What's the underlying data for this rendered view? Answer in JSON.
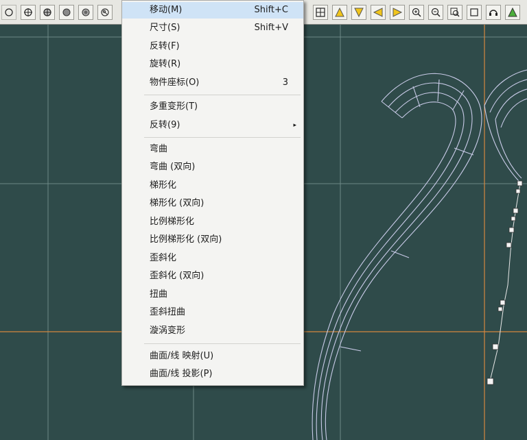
{
  "toolbar": {
    "left_buttons": [
      "circle-outline-icon",
      "crosshair-target-icon",
      "grid-circle-icon",
      "filled-circle-icon",
      "shaded-circle-icon",
      "rotate-view-icon"
    ],
    "right_buttons": [
      "grid-view-icon",
      "triangle-up-icon",
      "triangle-down-icon",
      "triangle-left-icon",
      "triangle-right-icon",
      "zoom-in-icon",
      "zoom-out-icon",
      "zoom-window-icon",
      "square-icon",
      "rotate-camera-icon",
      "triangle-green-icon"
    ]
  },
  "menu": {
    "items": [
      {
        "label": "移动(M)",
        "shortcut": "Shift+C"
      },
      {
        "label": "尺寸(S)",
        "shortcut": "Shift+V"
      },
      {
        "label": "反转(F)",
        "shortcut": ""
      },
      {
        "label": "旋转(R)",
        "shortcut": ""
      },
      {
        "label": "物件座标(O)",
        "shortcut": "3"
      },
      {
        "label": "多重变形(T)",
        "shortcut": ""
      },
      {
        "label": "反转(9)",
        "shortcut": ""
      },
      {
        "label": "弯曲",
        "shortcut": ""
      },
      {
        "label": "弯曲 (双向)",
        "shortcut": ""
      },
      {
        "label": "梯形化",
        "shortcut": ""
      },
      {
        "label": "梯形化 (双向)",
        "shortcut": ""
      },
      {
        "label": "比例梯形化",
        "shortcut": ""
      },
      {
        "label": "比例梯形化 (双向)",
        "shortcut": ""
      },
      {
        "label": "歪斜化",
        "shortcut": ""
      },
      {
        "label": "歪斜化 (双向)",
        "shortcut": ""
      },
      {
        "label": "扭曲",
        "shortcut": ""
      },
      {
        "label": "歪斜扭曲",
        "shortcut": ""
      },
      {
        "label": "漩涡变形",
        "shortcut": ""
      },
      {
        "label": "曲面/线 映射(U)",
        "shortcut": ""
      },
      {
        "label": "曲面/线 投影(P)",
        "shortcut": ""
      }
    ],
    "submenu_arrow": "▸"
  },
  "colors": {
    "viewport_bg": "#2f4b4a",
    "grid": "#6a8582",
    "axis": "#d4873f",
    "curve": "#c9cbe8",
    "menu_highlight": "#cfe3f6"
  }
}
